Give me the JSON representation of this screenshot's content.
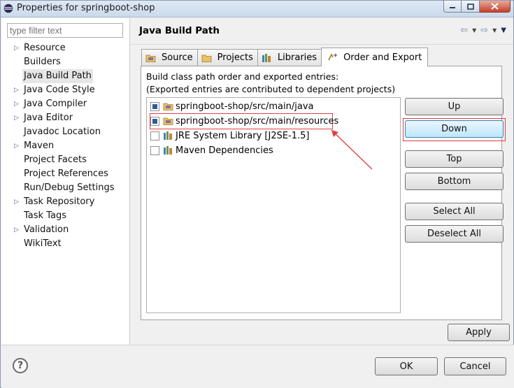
{
  "window": {
    "title": "Properties for springboot-shop",
    "controls": [
      "minimize-icon",
      "maximize-icon",
      "close-icon"
    ]
  },
  "sidebar": {
    "filter_placeholder": "type filter text",
    "items": [
      {
        "label": "Resource",
        "expandable": true
      },
      {
        "label": "Builders",
        "expandable": false
      },
      {
        "label": "Java Build Path",
        "expandable": false,
        "selected": true
      },
      {
        "label": "Java Code Style",
        "expandable": true
      },
      {
        "label": "Java Compiler",
        "expandable": true
      },
      {
        "label": "Java Editor",
        "expandable": true
      },
      {
        "label": "Javadoc Location",
        "expandable": false
      },
      {
        "label": "Maven",
        "expandable": true
      },
      {
        "label": "Project Facets",
        "expandable": false
      },
      {
        "label": "Project References",
        "expandable": false
      },
      {
        "label": "Run/Debug Settings",
        "expandable": false
      },
      {
        "label": "Task Repository",
        "expandable": true
      },
      {
        "label": "Task Tags",
        "expandable": false
      },
      {
        "label": "Validation",
        "expandable": true
      },
      {
        "label": "WikiText",
        "expandable": false
      }
    ]
  },
  "page": {
    "title": "Java Build Path",
    "nav_icons": [
      "back-arrow-icon",
      "dropdown-icon",
      "forward-arrow-icon",
      "dropdown-icon",
      "menu-icon"
    ]
  },
  "tabs": [
    {
      "label": "Source",
      "icon": "source-folder-icon",
      "active": false
    },
    {
      "label": "Projects",
      "icon": "project-folder-icon",
      "active": false
    },
    {
      "label": "Libraries",
      "icon": "library-icon",
      "active": false
    },
    {
      "label": "Order and Export",
      "icon": "order-export-icon",
      "active": true
    }
  ],
  "order_export": {
    "description_line1": "Build class path order and exported entries:",
    "description_line2": "(Exported entries are contributed to dependent projects)",
    "entries": [
      {
        "label": "springboot-shop/src/main/java",
        "checked": true,
        "icon": "source-folder-icon"
      },
      {
        "label": "springboot-shop/src/main/resources",
        "checked": true,
        "icon": "source-folder-icon",
        "highlighted": true
      },
      {
        "label": "JRE System Library [J2SE-1.5]",
        "checked": false,
        "icon": "library-icon"
      },
      {
        "label": "Maven Dependencies",
        "checked": false,
        "icon": "library-icon"
      }
    ],
    "buttons": {
      "up": "Up",
      "down": "Down",
      "top": "Top",
      "bottom": "Bottom",
      "select_all": "Select All",
      "deselect_all": "Deselect All"
    }
  },
  "apply_label": "Apply",
  "footer": {
    "help_glyph": "?",
    "ok_label": "OK",
    "cancel_label": "Cancel"
  },
  "colors": {
    "annotation_red": "#e04040",
    "focus_blue": "#3c7fb1"
  }
}
